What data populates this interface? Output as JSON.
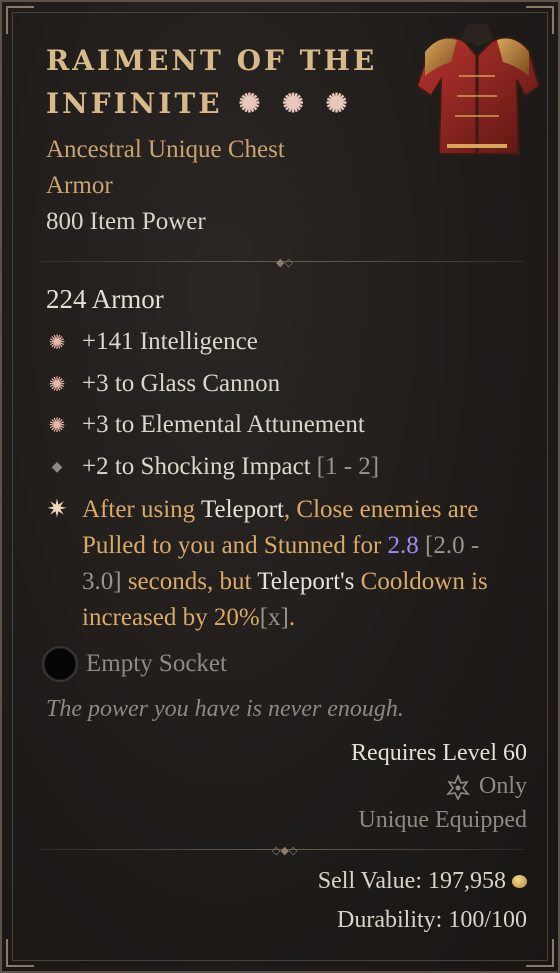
{
  "item": {
    "name_line1": "Raiment of the",
    "name_line2": "Infinite",
    "subtype_line1": "Ancestral Unique Chest",
    "subtype_line2": "Armor",
    "item_power": "800 Item Power",
    "armor": "224 Armor",
    "affixes": [
      {
        "text": "+141 Intelligence",
        "range": "",
        "bullet": "greater-affix-star-icon"
      },
      {
        "text": "+3 to Glass Cannon",
        "range": "",
        "bullet": "greater-affix-star-icon"
      },
      {
        "text": "+3 to Elemental Attunement",
        "range": "",
        "bullet": "greater-affix-star-icon"
      },
      {
        "text": "+2 to Shocking Impact",
        "range": "[1 - 2]",
        "bullet": "diamond-icon"
      }
    ],
    "unique_power": {
      "p1": "After using ",
      "p2": "Teleport",
      "p3": ", Close enemies are Pulled to you and Stunned for ",
      "p4": "2.8",
      "p5": " [2.0 - 3.0]",
      "p6": " seconds, but ",
      "p7": "Teleport's",
      "p8": " Cooldown is increased by 20%",
      "p9": "[x]",
      "p10": "."
    },
    "socket": "Empty Socket",
    "flavor": "The power you have is never enough.",
    "requires": "Requires Level 60",
    "class_only": "Only",
    "unique_equipped": "Unique Equipped",
    "sell_value": "Sell Value: 197,958",
    "durability": "Durability: 100/100"
  },
  "colors": {
    "title": "#d8b98a",
    "unique": "#d9a968",
    "highlight_blue": "#9d8cf5",
    "muted": "#9a948b"
  }
}
